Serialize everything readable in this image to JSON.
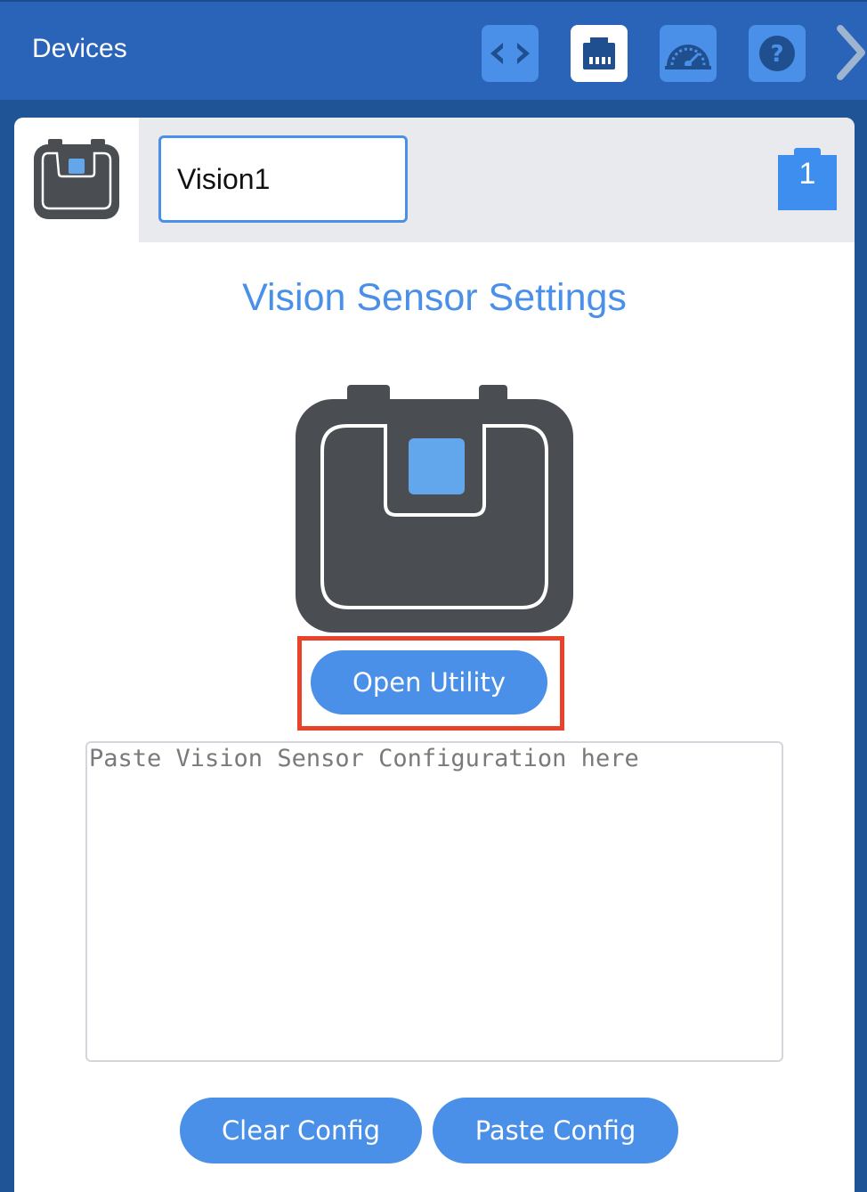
{
  "topbar": {
    "title": "Devices",
    "buttons": [
      {
        "icon": "code-brackets-icon",
        "active": false
      },
      {
        "icon": "port-plug-icon",
        "active": true
      },
      {
        "icon": "dashboard-gauge-icon",
        "active": false
      },
      {
        "icon": "help-question-icon",
        "active": false
      }
    ],
    "next_icon": "chevron-right-icon"
  },
  "device": {
    "name_value": "Vision1",
    "port_number": "1",
    "icon": "vision-sensor-icon"
  },
  "settings": {
    "title": "Vision Sensor Settings",
    "open_utility_label": "Open Utility",
    "config_placeholder": "Paste Vision Sensor Configuration here",
    "config_value": "",
    "clear_config_label": "Clear Config",
    "paste_config_label": "Paste Config"
  },
  "colors": {
    "topbar": "#2a64b8",
    "accent": "#4a90e8",
    "sensor_body": "#4a4e53",
    "sensor_lens": "#62a6ec",
    "highlight": "#e8422b"
  }
}
